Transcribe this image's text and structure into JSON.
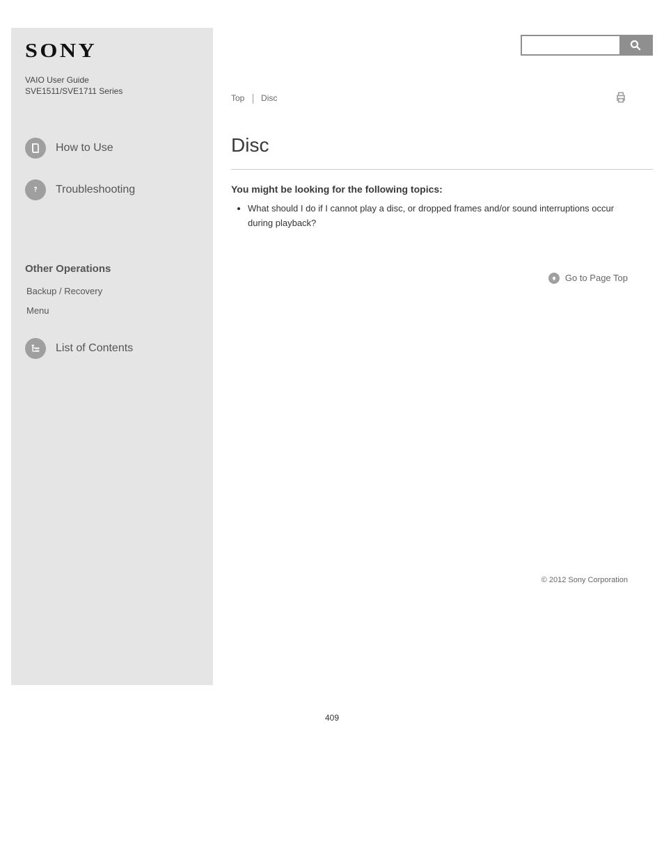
{
  "header": {
    "logo_text": "SONY",
    "product_line": "VAIO User Guide",
    "series": "SVE1511/SVE1711 Series"
  },
  "sidebar": {
    "nav": {
      "how_to_use": "How to Use",
      "troubleshooting": "Troubleshooting"
    },
    "other_ops": {
      "heading": "Other Operations",
      "links": [
        "Backup / Recovery",
        "Menu"
      ]
    },
    "contents_list": "List of Contents"
  },
  "search": {
    "placeholder": ""
  },
  "breadcrumb": {
    "top": "Top",
    "current": "Disc"
  },
  "article": {
    "title": "Disc",
    "subhead": "You might be looking for the following topics:",
    "items": [
      "What should I do if I cannot play a disc, or dropped frames and/or sound interruptions occur during playback?"
    ]
  },
  "go_top": "Go to Page Top",
  "copyright": "© 2012 Sony Corporation",
  "page_number": "409"
}
